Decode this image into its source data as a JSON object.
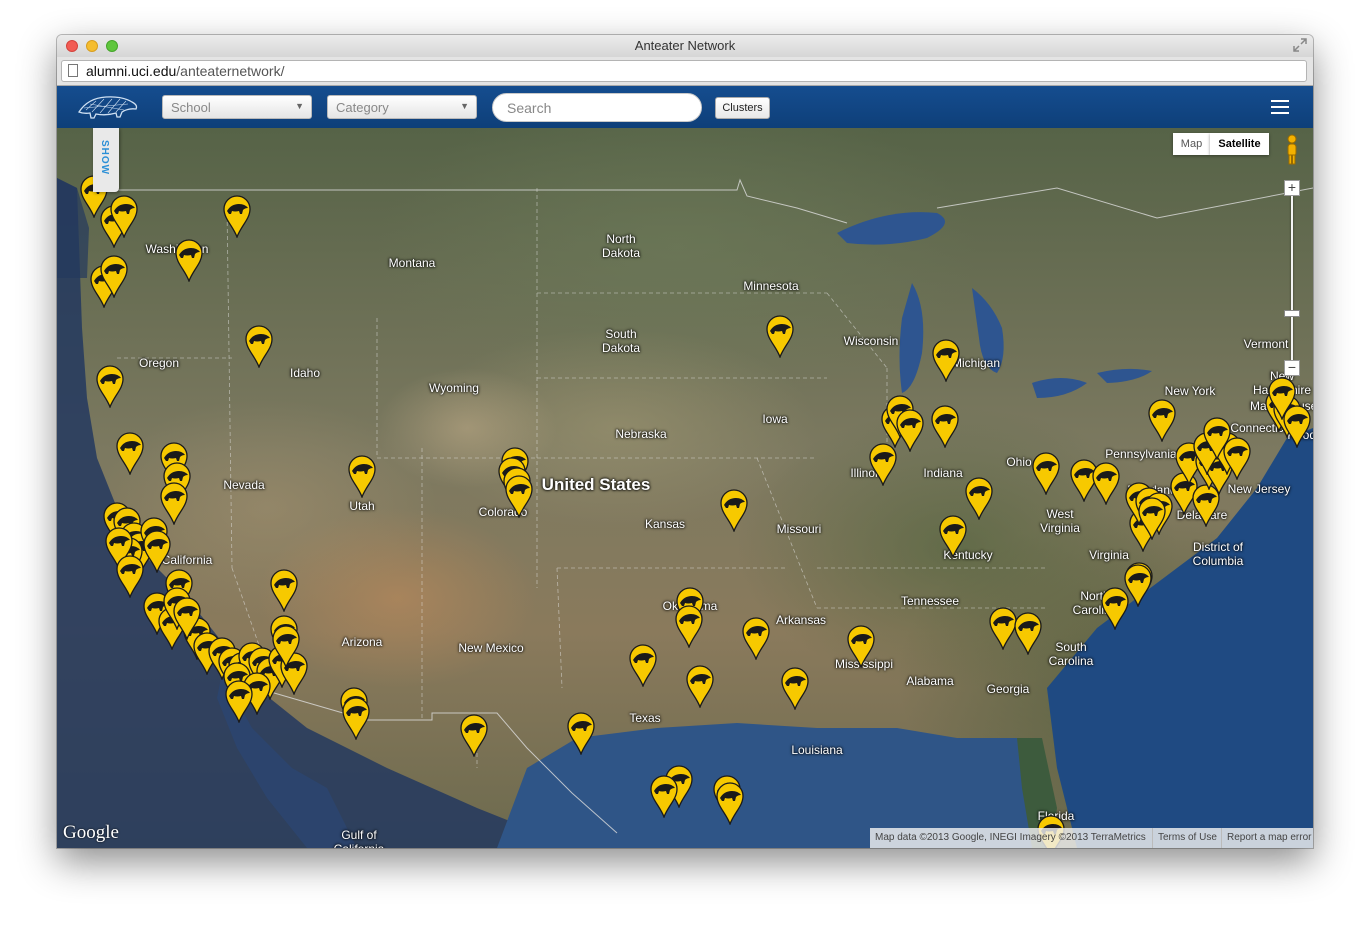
{
  "window": {
    "title": "Anteater Network",
    "url_domain": "alumni.uci.edu",
    "url_path": "/anteaternetwork/"
  },
  "navbar": {
    "school_label": "School",
    "category_label": "Category",
    "search_placeholder": "Search",
    "clusters_label": "Clusters"
  },
  "map": {
    "show_tab": "SHOW",
    "maptype_map": "Map",
    "maptype_satellite": "Satellite",
    "selected_type": "Satellite",
    "zoom_in": "+",
    "zoom_out": "−",
    "google_logo": "Google",
    "attribution_data": "Map data ©2013 Google, INEGI Imagery ©2013 TerraMetrics",
    "terms": "Terms of Use",
    "report": "Report a map error",
    "marker_color": "#f7c900",
    "labels": [
      {
        "text": "North\nDakota"
      },
      {
        "text": "Montana"
      },
      {
        "text": "Minnesota"
      },
      {
        "text": "Washington"
      },
      {
        "text": "South\nDakota"
      },
      {
        "text": "Wisconsin"
      },
      {
        "text": "Michigan"
      },
      {
        "text": "Oregon"
      },
      {
        "text": "Idaho"
      },
      {
        "text": "Wyoming"
      },
      {
        "text": "Vermont"
      },
      {
        "text": "New\nHampshire"
      },
      {
        "text": "New York"
      },
      {
        "text": "Massachusetts"
      },
      {
        "text": "Iowa"
      },
      {
        "text": "Nebraska"
      },
      {
        "text": "Connecticut"
      },
      {
        "text": "Rhode"
      },
      {
        "text": "Pennsylvania"
      },
      {
        "text": "Nevada"
      },
      {
        "text": "Illinois"
      },
      {
        "text": "Indiana"
      },
      {
        "text": "Ohio"
      },
      {
        "text": "United States"
      },
      {
        "text": "Maryland"
      },
      {
        "text": "New Jersey"
      },
      {
        "text": "Utah"
      },
      {
        "text": "Colorado"
      },
      {
        "text": "Kansas"
      },
      {
        "text": "Missouri"
      },
      {
        "text": "West\nVirginia"
      },
      {
        "text": "Delaware"
      },
      {
        "text": "District of\nColumbia"
      },
      {
        "text": "California"
      },
      {
        "text": "Kentucky"
      },
      {
        "text": "Virginia"
      },
      {
        "text": "Tennessee"
      },
      {
        "text": "Oklahoma"
      },
      {
        "text": "Arkansas"
      },
      {
        "text": "North\nCarolina"
      },
      {
        "text": "Arizona"
      },
      {
        "text": "New Mexico"
      },
      {
        "text": "South\nCarolina"
      },
      {
        "text": "Mississippi"
      },
      {
        "text": "Alabama"
      },
      {
        "text": "Georgia"
      },
      {
        "text": "Texas"
      },
      {
        "text": "Louisiana"
      },
      {
        "text": "Florida"
      },
      {
        "text": "Gulf of\nCalifornia"
      }
    ]
  }
}
